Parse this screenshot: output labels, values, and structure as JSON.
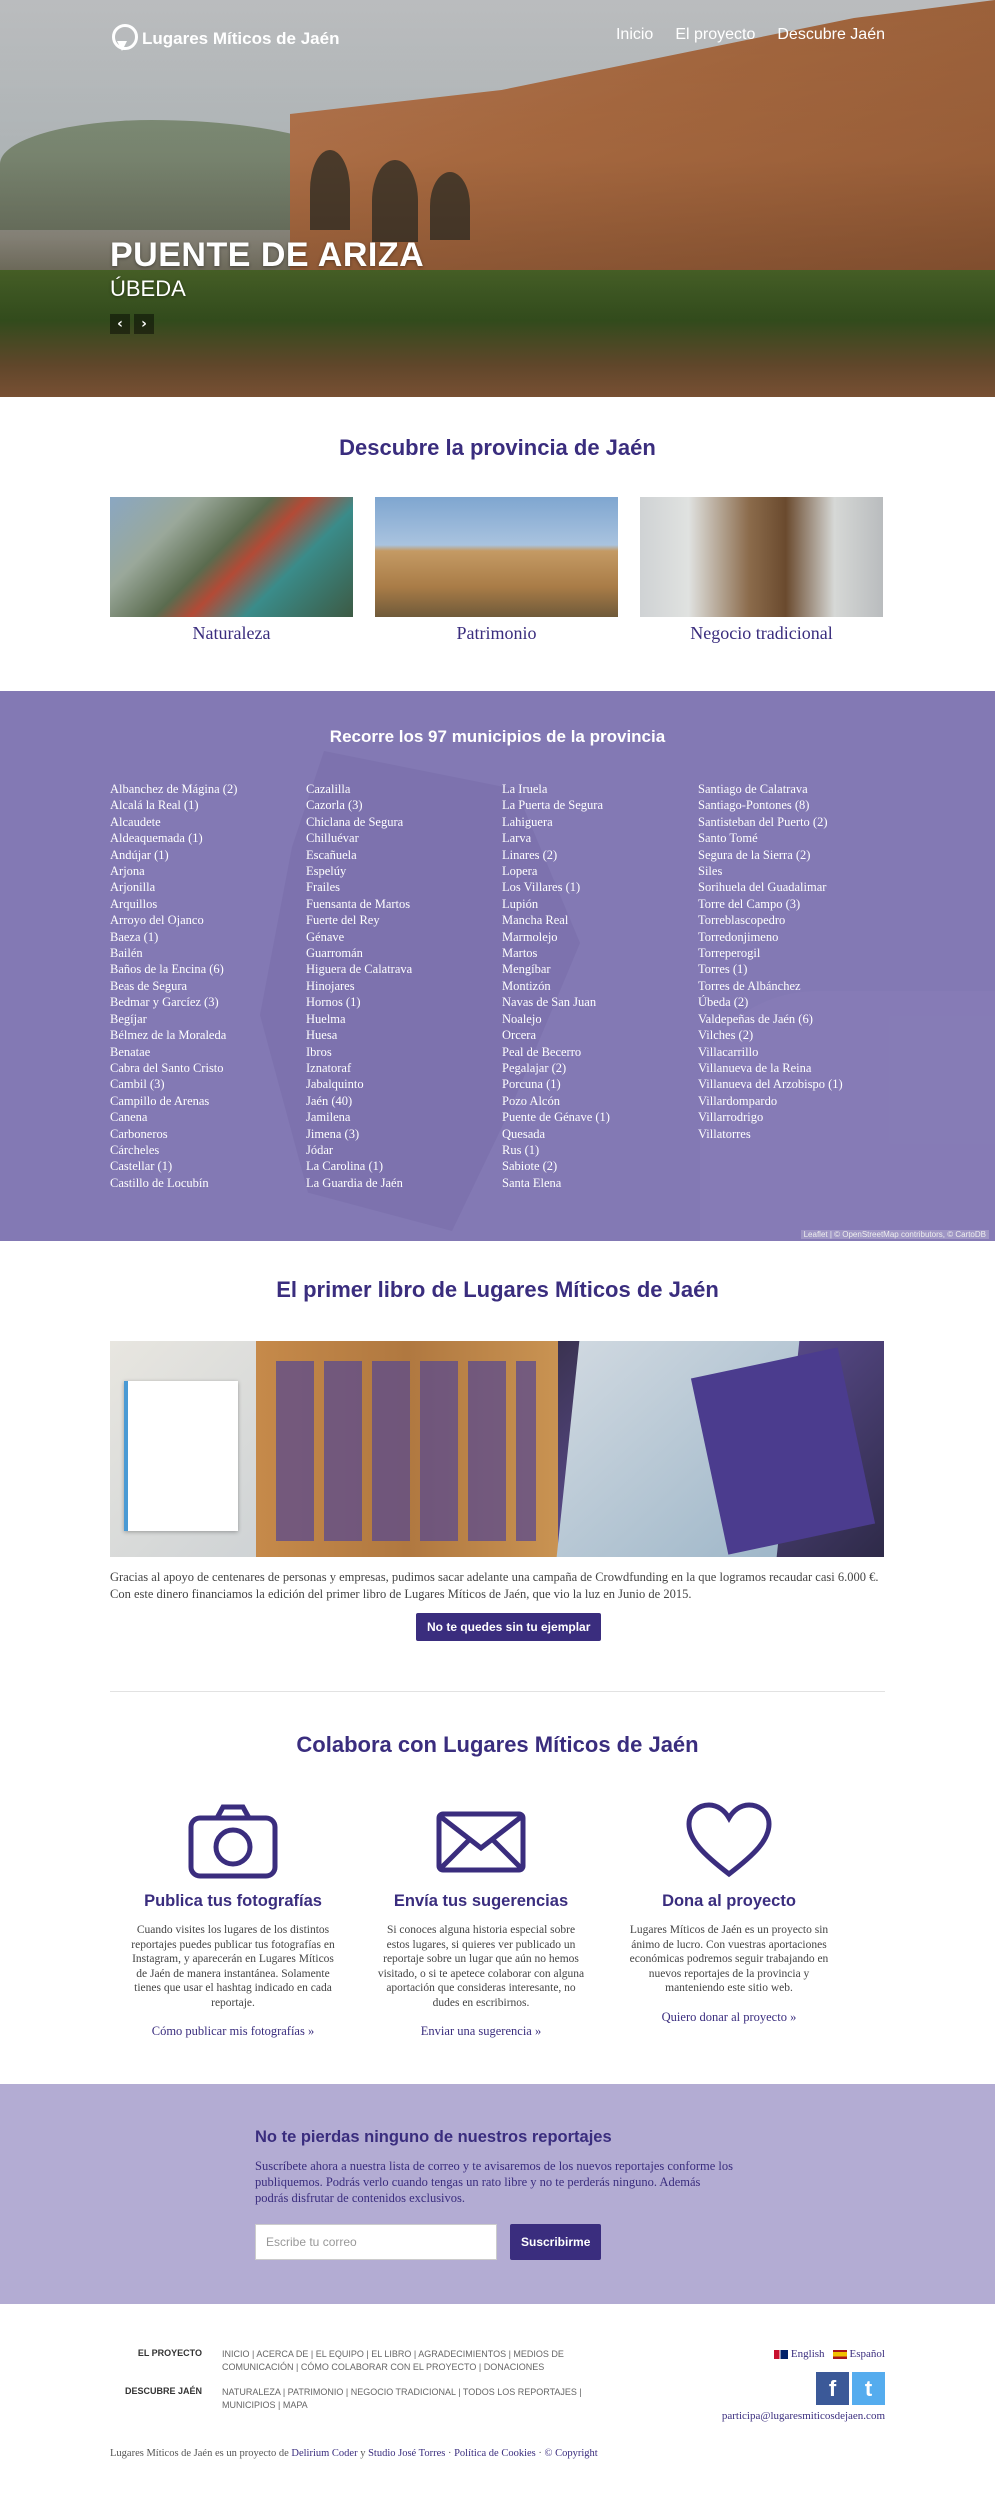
{
  "header": {
    "logo_text": "Lugares Míticos de Jaén",
    "nav": [
      "Inicio",
      "El proyecto",
      "Descubre Jaén"
    ]
  },
  "hero": {
    "title": "PUENTE DE ARIZA",
    "subtitle": "ÚBEDA",
    "prev": "‹",
    "next": "›"
  },
  "discover": {
    "heading": "Descubre la provincia de Jaén",
    "cards": [
      {
        "label": "Naturaleza"
      },
      {
        "label": "Patrimonio"
      },
      {
        "label": "Negocio tradicional"
      }
    ]
  },
  "municipios": {
    "heading": "Recorre los 97 municipios de la provincia",
    "columns": [
      [
        "Albanchez de Mágina (2)",
        "Alcalá la Real (1)",
        "Alcaudete",
        "Aldeaquemada (1)",
        "Andújar (1)",
        "Arjona",
        "Arjonilla",
        "Arquillos",
        "Arroyo del Ojanco",
        "Baeza (1)",
        "Bailén",
        "Baños de la Encina (6)",
        "Beas de Segura",
        "Bedmar y Garcíez (3)",
        "Begíjar",
        "Bélmez de la Moraleda",
        "Benatae",
        "Cabra del Santo Cristo",
        "Cambil (3)",
        "Campillo de Arenas",
        "Canena",
        "Carboneros",
        "Cárcheles",
        "Castellar (1)",
        "Castillo de Locubín"
      ],
      [
        "Cazalilla",
        "Cazorla (3)",
        "Chiclana de Segura",
        "Chilluévar",
        "Escañuela",
        "Espelúy",
        "Frailes",
        "Fuensanta de Martos",
        "Fuerte del Rey",
        "Génave",
        "Guarromán",
        "Higuera de Calatrava",
        "Hinojares",
        "Hornos (1)",
        "Huelma",
        "Huesa",
        "Ibros",
        "Iznatoraf",
        "Jabalquinto",
        "Jaén (40)",
        "Jamilena",
        "Jimena (3)",
        "Jódar",
        "La Carolina (1)",
        "La Guardia de Jaén"
      ],
      [
        "La Iruela",
        "La Puerta de Segura",
        "Lahiguera",
        "Larva",
        "Linares (2)",
        "Lopera",
        "Los Villares (1)",
        "Lupión",
        "Mancha Real",
        "Marmolejo",
        "Martos",
        "Mengíbar",
        "Montizón",
        "Navas de San Juan",
        "Noalejo",
        "Orcera",
        "Peal de Becerro",
        "Pegalajar (2)",
        "Porcuna (1)",
        "Pozo Alcón",
        "Puente de Génave (1)",
        "Quesada",
        "Rus (1)",
        "Sabiote (2)",
        "Santa Elena"
      ],
      [
        "Santiago de Calatrava",
        "Santiago-Pontones (8)",
        "Santisteban del Puerto (2)",
        "Santo Tomé",
        "Segura de la Sierra (2)",
        "Siles",
        "Sorihuela del Guadalimar",
        "Torre del Campo (3)",
        "Torreblascopedro",
        "Torredonjimeno",
        "Torreperogil",
        "Torres (1)",
        "Torres de Albánchez",
        "Úbeda (2)",
        "Valdepeñas de Jaén (6)",
        "Vilches (2)",
        "Villacarrillo",
        "Villanueva de la Reina",
        "Villanueva del Arzobispo (1)",
        "Villardompardo",
        "Villarrodrigo",
        "Villatorres"
      ]
    ],
    "attribution": "Leaflet | © OpenStreetMap contributors, © CartoDB"
  },
  "book": {
    "heading": "El primer libro de Lugares Míticos de Jaén",
    "description": "Gracias al apoyo de centenares de personas y empresas, pudimos sacar adelante una campaña de Crowdfunding en la que logramos recaudar casi 6.000 €. Con este dinero financiamos la edición del primer libro de Lugares Míticos de Jaén, que vio la luz en Junio de 2015.",
    "button": "No te quedes sin tu ejemplar"
  },
  "collab": {
    "heading": "Colabora con Lugares Míticos de Jaén",
    "items": [
      {
        "icon": "camera-icon",
        "title": "Publica tus fotografías",
        "text": "Cuando visites los lugares de los distintos reportajes puedes publicar tus fotografías en Instagram, y aparecerán en Lugares Míticos de Jaén de manera instantánea. Solamente tienes que usar el hashtag indicado en cada reportaje.",
        "link": "Cómo publicar mis fotografías »"
      },
      {
        "icon": "envelope-icon",
        "title": "Envía tus sugerencias",
        "text": "Si conoces alguna historia especial sobre estos lugares, si quieres ver publicado un reportaje sobre un lugar que aún no hemos visitado, o si te apetece colaborar con alguna aportación que consideras interesante, no dudes en escribirnos.",
        "link": "Enviar una sugerencia »"
      },
      {
        "icon": "heart-icon",
        "title": "Dona al proyecto",
        "text": "Lugares Míticos de Jaén es un proyecto sin ánimo de lucro. Con vuestras aportaciones económicas podremos seguir trabajando en nuevos reportajes de la provincia y manteniendo este sitio web.",
        "link": "Quiero donar al proyecto »"
      }
    ]
  },
  "newsletter": {
    "title": "No te pierdas ninguno de nuestros reportajes",
    "text": "Suscríbete ahora a nuestra lista de correo y te avisaremos de los nuevos reportajes conforme los publiquemos. Podrás verlo cuando tengas un rato libre y no te perderás ninguno. Además podrás disfrutar de contenidos exclusivos.",
    "placeholder": "Escribe tu correo",
    "button": "Suscribirme"
  },
  "footer": {
    "proyecto_label": "EL PROYECTO",
    "proyecto_links": "INICIO | ACERCA DE | EL EQUIPO | EL LIBRO | AGRADECIMIENTOS | MEDIOS DE COMUNICACIÓN | CÓMO COLABORAR CON EL PROYECTO | DONACIONES",
    "descubre_label": "DESCUBRE JAÉN",
    "descubre_links": "NATURALEZA | PATRIMONIO | NEGOCIO TRADICIONAL | TODOS LOS REPORTAJES | MUNICIPIOS | MAPA",
    "lang_en": "English",
    "lang_es": "Español",
    "facebook": "f",
    "twitter": "t",
    "email": "participa@lugaresmiticosdejaen.com",
    "copy_prefix": "Lugares Míticos de Jaén es un proyecto de",
    "copy_link1": "Delirium Coder",
    "copy_and": "y",
    "copy_link2": "Studio José Torres",
    "copy_sep1": "·",
    "copy_link3": "Política de Cookies",
    "copy_sep2": "·",
    "copy_link4": "© Copyright"
  }
}
